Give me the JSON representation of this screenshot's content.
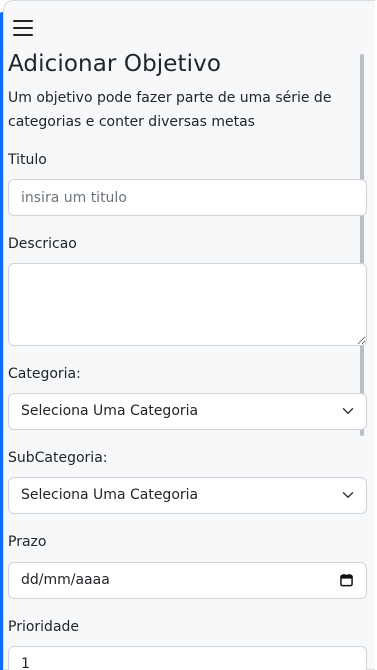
{
  "header": {
    "menu_icon": "hamburger-menu-icon"
  },
  "page": {
    "title": "Adicionar Objetivo",
    "description": "Um objetivo pode fazer parte de uma série de categorias e conter diversas metas"
  },
  "form": {
    "titulo": {
      "label": "Titulo",
      "placeholder": "insira um titulo",
      "value": ""
    },
    "descricao": {
      "label": "Descricao",
      "value": ""
    },
    "categoria": {
      "label": "Categoria:",
      "selected": "Seleciona Uma Categoria"
    },
    "subcategoria": {
      "label": "SubCategoria:",
      "selected": "Seleciona Uma Categoria"
    },
    "prazo": {
      "label": "Prazo",
      "value": "dd/mm/aaaa"
    },
    "prioridade": {
      "label": "Prioridade",
      "value": "1"
    }
  },
  "colors": {
    "accent": "#0d6efd",
    "background": "#f6f8fa",
    "border": "#ced4da"
  }
}
